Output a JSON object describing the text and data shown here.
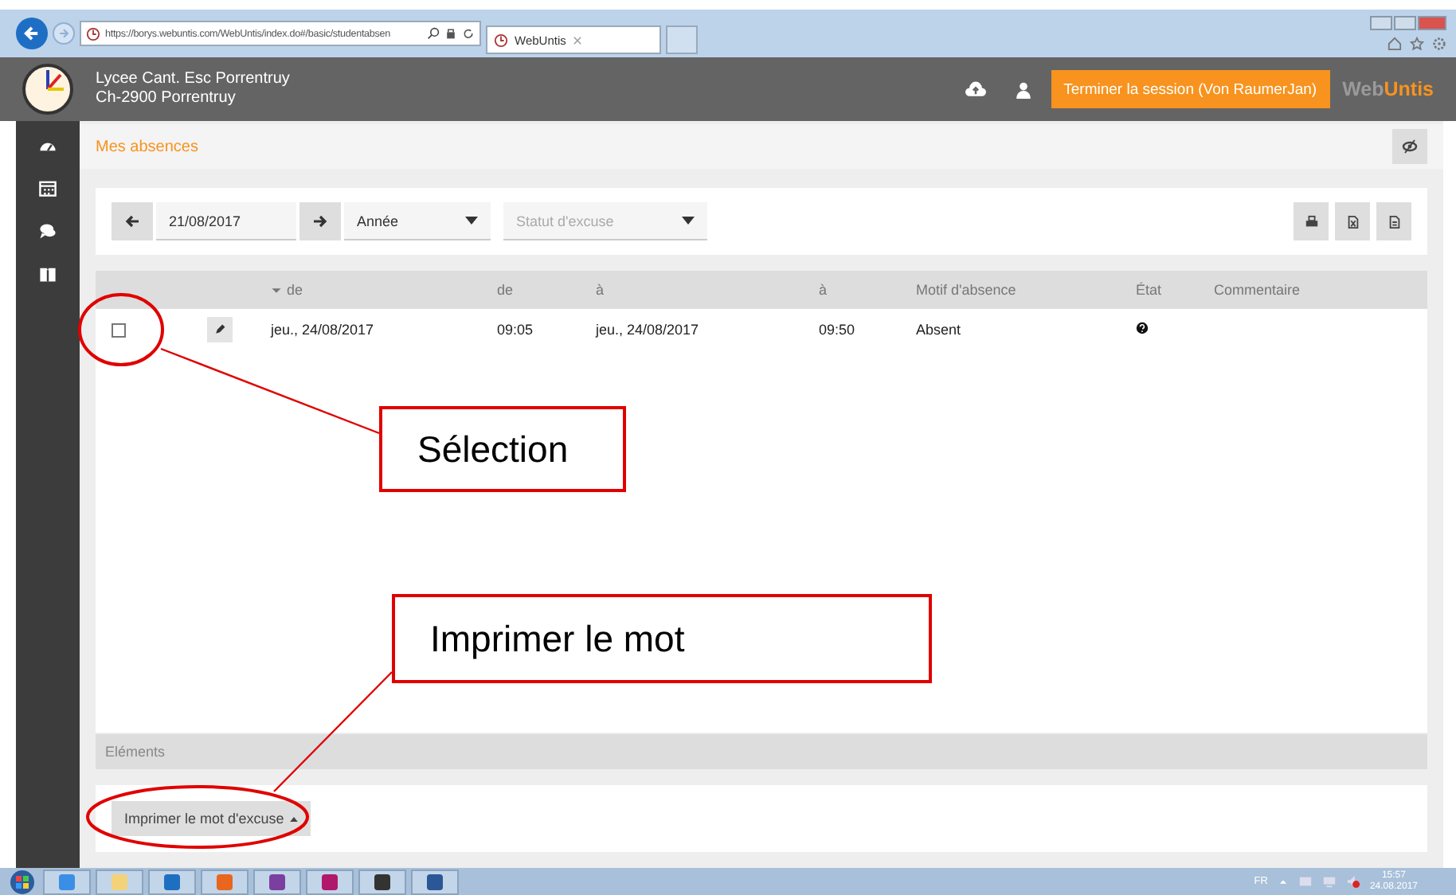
{
  "browser": {
    "address": "https://borys.webuntis.com/WebUntis/index.do#/basic/studentabsen",
    "tab_title": "WebUntis"
  },
  "header": {
    "school_name": "Lycee Cant. Esc Porrentruy",
    "school_address": "Ch-2900 Porrentruy",
    "logout_button": "Terminer la session (Von RaumerJan)",
    "brand_prefix": "Web",
    "brand_suffix": "Untis"
  },
  "page_title": "Mes absences",
  "filters": {
    "date": "21/08/2017",
    "period": "Année",
    "excuse_status_placeholder": "Statut d'excuse"
  },
  "table": {
    "columns": [
      {
        "label": "de",
        "sorted": true
      },
      {
        "label": "de",
        "sorted": false
      },
      {
        "label": "à",
        "sorted": false
      },
      {
        "label": "à",
        "sorted": false
      },
      {
        "label": "Motif d'absence",
        "sorted": false
      },
      {
        "label": "État",
        "sorted": false
      },
      {
        "label": "Commentaire",
        "sorted": false
      }
    ],
    "rows": [
      {
        "checked": false,
        "cells": [
          "jeu., 24/08/2017",
          "09:05",
          "jeu., 24/08/2017",
          "09:50",
          "Absent"
        ]
      }
    ]
  },
  "footer": {
    "section_label": "Eléments",
    "print_button": "Imprimer le mot d'excuse"
  },
  "annotations": [
    {
      "label": "Sélection"
    },
    {
      "label": "Imprimer le mot"
    }
  ],
  "taskbar": {
    "language": "FR",
    "time": "15:57",
    "date": "24.08.2017"
  }
}
